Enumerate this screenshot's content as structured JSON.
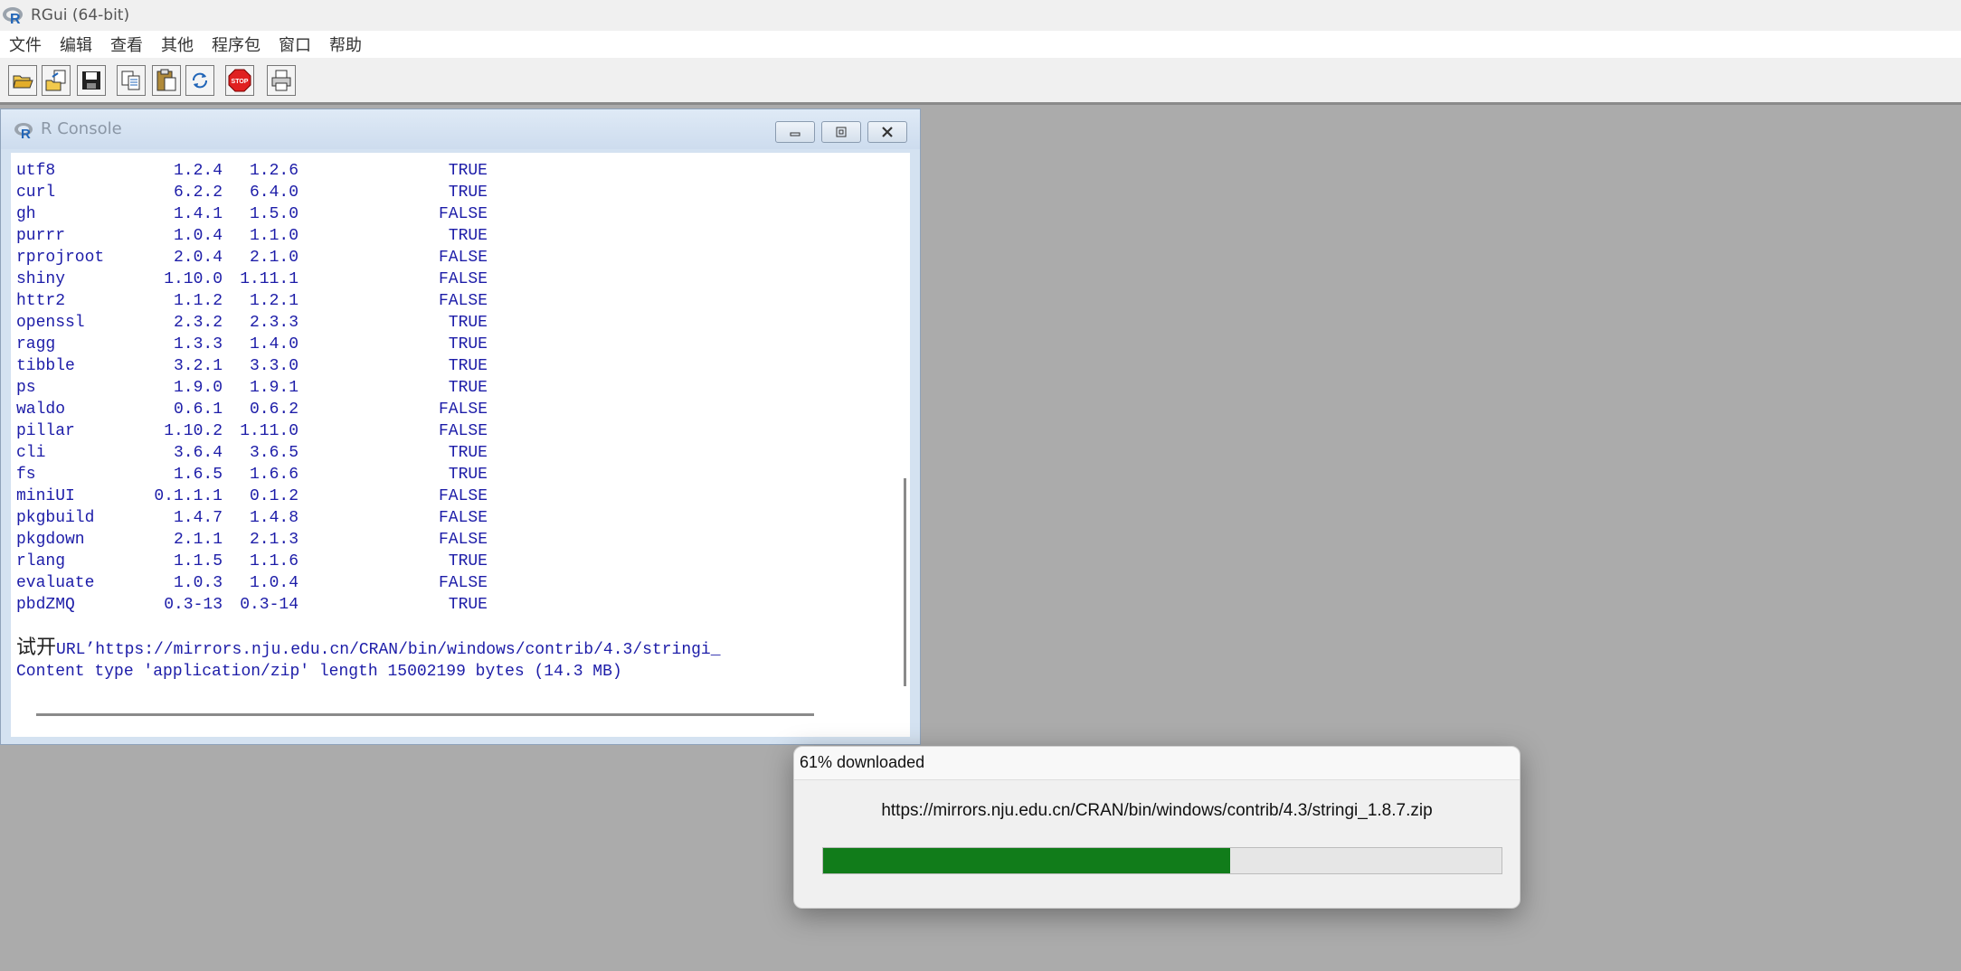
{
  "app": {
    "title": "RGui (64-bit)"
  },
  "menu": {
    "items": [
      "文件",
      "编辑",
      "查看",
      "其他",
      "程序包",
      "窗口",
      "帮助"
    ]
  },
  "toolbar": {
    "buttons": [
      "open-script-icon",
      "load-workspace-icon",
      "save-icon",
      "copy-icon",
      "paste-icon",
      "refresh-icon",
      "stop-icon",
      "print-icon"
    ],
    "stop_label": "STOP"
  },
  "console": {
    "title": "R Console",
    "rows": [
      {
        "name": "utf8",
        "installed": "1.2.4",
        "available": "1.2.6",
        "flag": "TRUE"
      },
      {
        "name": "curl",
        "installed": "6.2.2",
        "available": "6.4.0",
        "flag": "TRUE"
      },
      {
        "name": "gh",
        "installed": "1.4.1",
        "available": "1.5.0",
        "flag": "FALSE"
      },
      {
        "name": "purrr",
        "installed": "1.0.4",
        "available": "1.1.0",
        "flag": "TRUE"
      },
      {
        "name": "rprojroot",
        "installed": "2.0.4",
        "available": "2.1.0",
        "flag": "FALSE"
      },
      {
        "name": "shiny",
        "installed": "1.10.0",
        "available": "1.11.1",
        "flag": "FALSE"
      },
      {
        "name": "httr2",
        "installed": "1.1.2",
        "available": "1.2.1",
        "flag": "FALSE"
      },
      {
        "name": "openssl",
        "installed": "2.3.2",
        "available": "2.3.3",
        "flag": "TRUE"
      },
      {
        "name": "ragg",
        "installed": "1.3.3",
        "available": "1.4.0",
        "flag": "TRUE"
      },
      {
        "name": "tibble",
        "installed": "3.2.1",
        "available": "3.3.0",
        "flag": "TRUE"
      },
      {
        "name": "ps",
        "installed": "1.9.0",
        "available": "1.9.1",
        "flag": "TRUE"
      },
      {
        "name": "waldo",
        "installed": "0.6.1",
        "available": "0.6.2",
        "flag": "FALSE"
      },
      {
        "name": "pillar",
        "installed": "1.10.2",
        "available": "1.11.0",
        "flag": "FALSE"
      },
      {
        "name": "cli",
        "installed": "3.6.4",
        "available": "3.6.5",
        "flag": "TRUE"
      },
      {
        "name": "fs",
        "installed": "1.6.5",
        "available": "1.6.6",
        "flag": "TRUE"
      },
      {
        "name": "miniUI",
        "installed": "0.1.1.1",
        "available": "0.1.2",
        "flag": "FALSE"
      },
      {
        "name": "pkgbuild",
        "installed": "1.4.7",
        "available": "1.4.8",
        "flag": "FALSE"
      },
      {
        "name": "pkgdown",
        "installed": "2.1.1",
        "available": "2.1.3",
        "flag": "FALSE"
      },
      {
        "name": "rlang",
        "installed": "1.1.5",
        "available": "1.1.6",
        "flag": "TRUE"
      },
      {
        "name": "evaluate",
        "installed": "1.0.3",
        "available": "1.0.4",
        "flag": "FALSE"
      },
      {
        "name": "pbdZMQ",
        "installed": "0.3-13",
        "available": "0.3-14",
        "flag": "TRUE"
      }
    ],
    "trying_prefix": "试开",
    "trying_rest": "URL’https://mirrors.nju.edu.cn/CRAN/bin/windows/contrib/4.3/stringi_",
    "content_line": "Content type 'application/zip' length 15002199 bytes (14.3 MB)"
  },
  "download": {
    "title": "61% downloaded",
    "url": "https://mirrors.nju.edu.cn/CRAN/bin/windows/contrib/4.3/stringi_1.8.7.zip",
    "progress": 0.6,
    "fill_color": "#117c1a"
  }
}
